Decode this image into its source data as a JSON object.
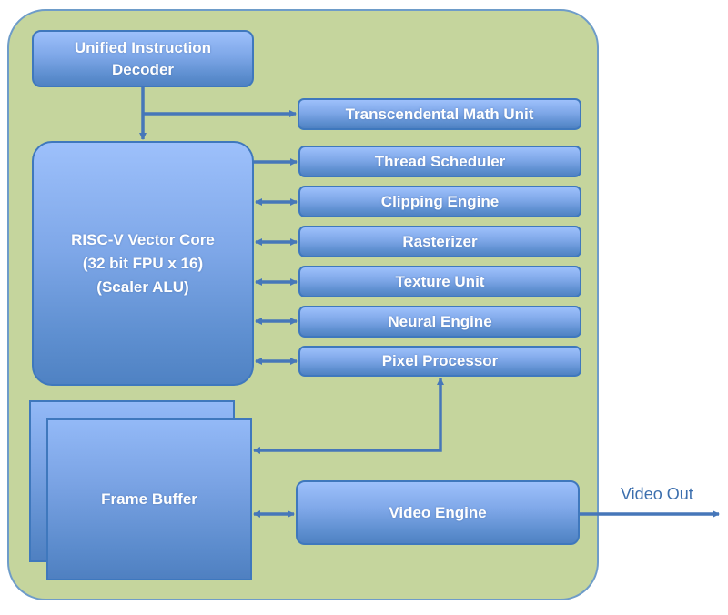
{
  "diagram": {
    "title": "",
    "blocks": {
      "decoder": {
        "line1": "Unified Instruction",
        "line2": "Decoder"
      },
      "transcendental": "Transcendental Math Unit",
      "thread_scheduler": "Thread Scheduler",
      "clipping_engine": "Clipping Engine",
      "rasterizer": "Rasterizer",
      "texture_unit": "Texture Unit",
      "neural_engine": "Neural Engine",
      "pixel_processor": "Pixel Processor",
      "core": {
        "line1": "RISC-V Vector Core",
        "line2": "(32 bit FPU x 16)",
        "line3": "(Scaler ALU)"
      },
      "frame_buffer": "Frame Buffer",
      "video_engine": "Video Engine"
    },
    "external_label": "Video Out",
    "connections": [
      {
        "from": "decoder",
        "to": "core",
        "direction": "one-way"
      },
      {
        "from": "decoder",
        "to": "transcendental",
        "direction": "one-way"
      },
      {
        "from": "core",
        "to": "thread_scheduler",
        "direction": "one-way"
      },
      {
        "from": "core",
        "to": "clipping_engine",
        "direction": "bidirectional"
      },
      {
        "from": "core",
        "to": "rasterizer",
        "direction": "bidirectional"
      },
      {
        "from": "core",
        "to": "texture_unit",
        "direction": "bidirectional"
      },
      {
        "from": "core",
        "to": "neural_engine",
        "direction": "bidirectional"
      },
      {
        "from": "core",
        "to": "pixel_processor",
        "direction": "bidirectional"
      },
      {
        "from": "frame_buffer",
        "to": "pixel_processor",
        "direction": "bidirectional"
      },
      {
        "from": "frame_buffer",
        "to": "video_engine",
        "direction": "bidirectional"
      },
      {
        "from": "video_engine",
        "to": "video_out",
        "direction": "one-way"
      }
    ],
    "colors": {
      "container_fill": "#c5d59d",
      "container_border": "#6e9cc9",
      "block_top": "#9dc0fb",
      "block_bottom": "#4f82c3",
      "block_border": "#3f78bd",
      "arrow": "#4677b9",
      "label_text": "#3c6fae"
    }
  }
}
